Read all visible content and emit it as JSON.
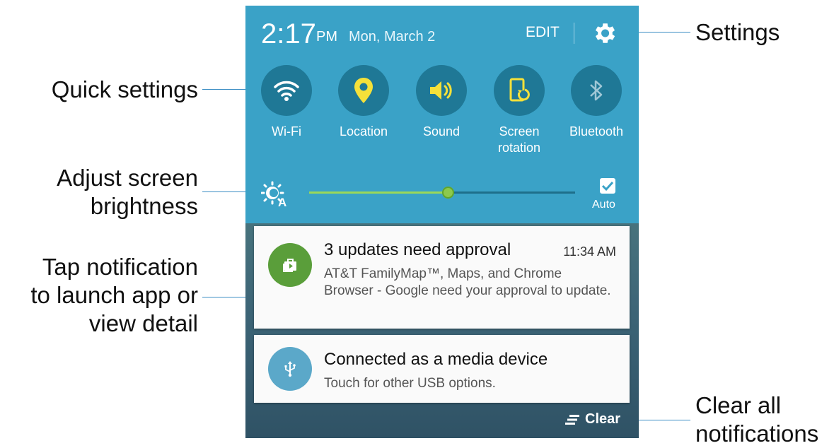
{
  "callouts": {
    "settings": "Settings",
    "quick_settings": "Quick settings",
    "brightness_line1": "Adjust screen",
    "brightness_line2": "brightness",
    "tap_line1": "Tap notification",
    "tap_line2": "to launch app or",
    "tap_line3": "view detail",
    "clear_line1": "Clear all",
    "clear_line2": "notifications"
  },
  "status": {
    "time": "2:17",
    "ampm": "PM",
    "date": "Mon, March 2",
    "edit_label": "EDIT"
  },
  "quick_settings": [
    {
      "label": "Wi-Fi",
      "icon": "wifi-icon"
    },
    {
      "label": "Location",
      "icon": "location-pin-icon"
    },
    {
      "label": "Sound",
      "icon": "speaker-icon"
    },
    {
      "label": "Screen",
      "label2": "rotation",
      "icon": "screen-rotation-icon"
    },
    {
      "label": "Bluetooth",
      "icon": "bluetooth-icon"
    }
  ],
  "brightness": {
    "level": 0.52,
    "auto_label": "Auto",
    "auto_checked": true
  },
  "notifications": [
    {
      "title": "3 updates need approval",
      "time": "11:34 AM",
      "body": "AT&T FamilyMap™, Maps, and Chrome Browser - Google need your approval to update.",
      "icon": "app-updates-icon",
      "icon_color": "#5a9e3a"
    },
    {
      "title": "Connected as a media device",
      "body": "Touch for other USB options.",
      "icon": "usb-icon",
      "icon_color": "#5ba8c9"
    }
  ],
  "clear_label": "Clear",
  "colors": {
    "panel": "#3aa2c7",
    "tile": "#1f7896",
    "icon_yellow": "#f5e13a",
    "leader": "#3b8ec4"
  }
}
